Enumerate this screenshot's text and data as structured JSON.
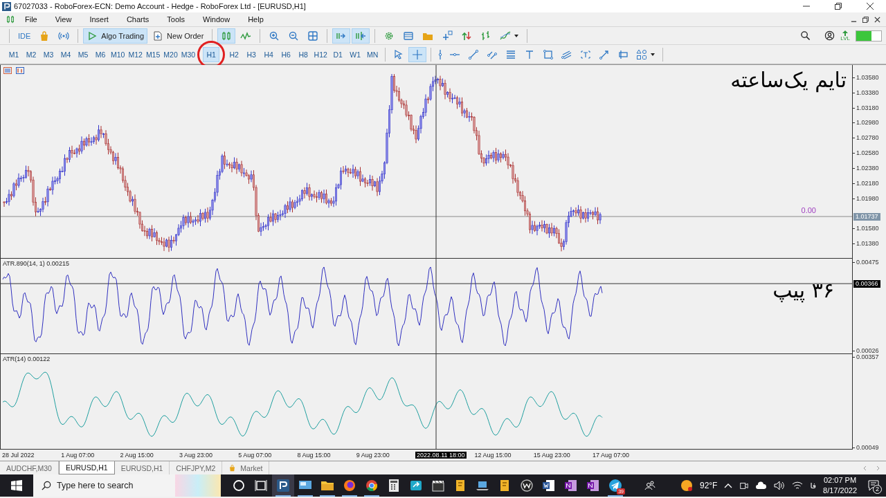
{
  "window": {
    "title": "67027033 - RoboForex-ECN: Demo Account - Hedge - RoboForex Ltd - [EURUSD,H1]"
  },
  "menu": [
    "File",
    "View",
    "Insert",
    "Charts",
    "Tools",
    "Window",
    "Help"
  ],
  "toolbar": [
    {
      "kind": "ide",
      "label": "IDE",
      "selected": false
    },
    {
      "kind": "market",
      "selected": false
    },
    {
      "kind": "signals",
      "selected": false
    },
    {
      "kind": "separator"
    },
    {
      "kind": "algo",
      "label": "Algo Trading",
      "selected": true
    },
    {
      "kind": "order",
      "label": "New Order",
      "selected": false
    },
    {
      "kind": "separator"
    },
    {
      "kind": "candles",
      "selected": true
    },
    {
      "kind": "line-chart",
      "selected": false
    },
    {
      "kind": "separator"
    },
    {
      "kind": "zoom-in",
      "selected": false
    },
    {
      "kind": "zoom-out",
      "selected": false
    },
    {
      "kind": "grid",
      "selected": false
    },
    {
      "kind": "separator"
    },
    {
      "kind": "autoscroll",
      "selected": true
    },
    {
      "kind": "chart-shift",
      "selected": true
    },
    {
      "kind": "separator"
    },
    {
      "kind": "gear",
      "selected": false
    },
    {
      "kind": "table",
      "selected": false
    },
    {
      "kind": "folder",
      "selected": false
    },
    {
      "kind": "plus",
      "selected": false
    },
    {
      "kind": "updown",
      "selected": false
    },
    {
      "kind": "bars",
      "selected": false
    },
    {
      "kind": "indicators",
      "selected": false
    }
  ],
  "right_tools": {
    "lvl_label": "LVL"
  },
  "timeframes": [
    {
      "label": "M1",
      "selected": false,
      "circled": false
    },
    {
      "label": "M2",
      "selected": false,
      "circled": false
    },
    {
      "label": "M3",
      "selected": false,
      "circled": false
    },
    {
      "label": "M4",
      "selected": false,
      "circled": false
    },
    {
      "label": "M5",
      "selected": false,
      "circled": false
    },
    {
      "label": "M6",
      "selected": false,
      "circled": false
    },
    {
      "label": "M10",
      "selected": false,
      "circled": false
    },
    {
      "label": "M12",
      "selected": false,
      "circled": false
    },
    {
      "label": "M15",
      "selected": false,
      "circled": false
    },
    {
      "label": "M20",
      "selected": false,
      "circled": false
    },
    {
      "label": "M30",
      "selected": false,
      "circled": false
    },
    {
      "label": "H1",
      "selected": true,
      "circled": true
    },
    {
      "label": "H2",
      "selected": false,
      "circled": false
    },
    {
      "label": "H3",
      "selected": false,
      "circled": false
    },
    {
      "label": "H4",
      "selected": false,
      "circled": false
    },
    {
      "label": "H6",
      "selected": false,
      "circled": false
    },
    {
      "label": "H8",
      "selected": false,
      "circled": false
    },
    {
      "label": "H12",
      "selected": false,
      "circled": false
    },
    {
      "label": "D1",
      "selected": false,
      "circled": false
    },
    {
      "label": "W1",
      "selected": false,
      "circled": false
    },
    {
      "label": "MN",
      "selected": false,
      "circled": false
    }
  ],
  "drawing_tools": [
    {
      "kind": "cursor",
      "selected": false
    },
    {
      "kind": "crosshair",
      "selected": true
    },
    {
      "kind": "separator"
    },
    {
      "kind": "vline",
      "selected": false
    },
    {
      "kind": "hline",
      "selected": false
    },
    {
      "kind": "trendline",
      "selected": false
    },
    {
      "kind": "channel",
      "selected": false
    },
    {
      "kind": "fibo",
      "selected": false
    },
    {
      "kind": "text",
      "selected": false
    },
    {
      "kind": "rect",
      "selected": false
    },
    {
      "kind": "pitchfork",
      "selected": false
    },
    {
      "kind": "label",
      "selected": false
    },
    {
      "kind": "arrow",
      "selected": false
    },
    {
      "kind": "ruler",
      "selected": false
    },
    {
      "kind": "shapes",
      "selected": false
    }
  ],
  "chart": {
    "price_pane": {
      "axis": [
        "1.03580",
        "1.03380",
        "1.03180",
        "1.02980",
        "1.02780",
        "1.02580",
        "1.02380",
        "1.02180",
        "1.01980",
        "1.01580",
        "1.01380"
      ],
      "current_price": "1.01737",
      "level_label": "0.00",
      "annotation": "تایم یک‌ساعته"
    },
    "indicator_panes": [
      {
        "kind": "atr890",
        "label": "ATR.890(14, 1) 0.00215",
        "axis": [
          "0.00475",
          "0.00026"
        ],
        "crosshair_value": "0.00366",
        "annotation": "۳۶ پیپ"
      },
      {
        "kind": "atr",
        "label": "ATR(14) 0.00122",
        "axis": [
          "0.00357",
          "0.00049"
        ]
      }
    ],
    "time_axis": [
      {
        "label": "28 Jul 2022",
        "crosshair": false
      },
      {
        "label": "1 Aug 07:00",
        "crosshair": false
      },
      {
        "label": "2 Aug 15:00",
        "crosshair": false
      },
      {
        "label": "3 Aug 23:00",
        "crosshair": false
      },
      {
        "label": "5 Aug 07:00",
        "crosshair": false
      },
      {
        "label": "8 Aug 15:00",
        "crosshair": false
      },
      {
        "label": "9 Aug 23:00",
        "crosshair": false
      },
      {
        "label": "2022.08.11 18:00",
        "crosshair": true
      },
      {
        "label": "12 Aug 15:00",
        "crosshair": false
      },
      {
        "label": "15 Aug 23:00",
        "crosshair": false
      },
      {
        "label": "17 Aug 07:00",
        "crosshair": false
      }
    ]
  },
  "chart_tabs": [
    {
      "kind": "chart",
      "label": "AUDCHF,M30",
      "selected": false
    },
    {
      "kind": "chart",
      "label": "EURUSD,H1",
      "selected": true
    },
    {
      "kind": "chart",
      "label": "EURUSD,H1",
      "selected": false
    },
    {
      "kind": "chart",
      "label": "CHFJPY,M2",
      "selected": false
    },
    {
      "kind": "market",
      "label": "Market",
      "selected": false
    }
  ],
  "taskbar": {
    "search_placeholder": "Type here to search",
    "apps": [
      {
        "kind": "cortana",
        "open": false,
        "selected": false
      },
      {
        "kind": "task-view",
        "open": false,
        "selected": false
      },
      {
        "kind": "terminal",
        "open": true,
        "selected": true
      },
      {
        "kind": "screen",
        "open": true,
        "selected": false
      },
      {
        "kind": "folder",
        "open": true,
        "selected": false
      },
      {
        "kind": "firefox",
        "open": true,
        "selected": false
      },
      {
        "kind": "chrome",
        "open": true,
        "selected": false
      },
      {
        "kind": "calculator",
        "open": false,
        "selected": false
      },
      {
        "kind": "share",
        "open": false,
        "selected": false
      },
      {
        "kind": "clapper",
        "open": false,
        "selected": false
      },
      {
        "kind": "book",
        "open": false,
        "selected": false
      },
      {
        "kind": "laptop",
        "open": false,
        "selected": false
      },
      {
        "kind": "book",
        "open": false,
        "selected": false
      },
      {
        "kind": "w-circle",
        "open": false,
        "selected": false
      },
      {
        "kind": "word",
        "open": false,
        "selected": false
      },
      {
        "kind": "notebook",
        "open": false,
        "selected": false
      },
      {
        "kind": "notebook",
        "open": false,
        "selected": false
      },
      {
        "kind": "telegram",
        "open": true,
        "selected": false,
        "badge": "39"
      }
    ],
    "weather": "92°F",
    "language": "فا",
    "time": "02:07 PM",
    "date": "8/17/2022",
    "notifications": "2"
  }
}
